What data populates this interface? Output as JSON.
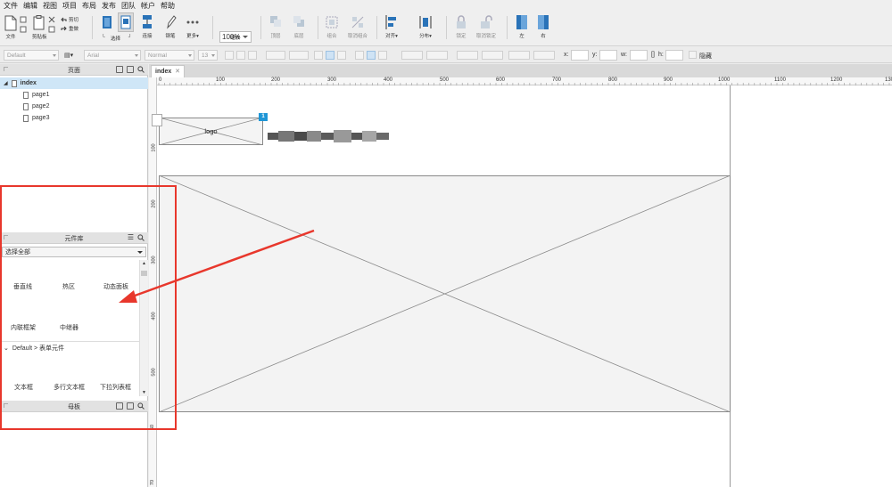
{
  "menu": [
    "文件",
    "编辑",
    "视图",
    "项目",
    "布局",
    "发布",
    "团队",
    "帐户",
    "帮助"
  ],
  "toolbar": {
    "file": "文件",
    "clipboard": "剪贴板",
    "cut": "剪切",
    "redo": "重做",
    "select": "选择",
    "connect": "连接",
    "pen": "钢笔",
    "more": "更多▾",
    "zoom_value": "100%",
    "zoom": "缩放",
    "top": "顶层",
    "bottom": "底层",
    "group": "组合",
    "ungroup": "取消组合",
    "align": "对齐▾",
    "distribute": "分布▾",
    "lock": "锁定",
    "unlock": "取消锁定",
    "left": "左",
    "right": "右"
  },
  "format": {
    "style": "Default",
    "font": "Arial",
    "weight": "Normal",
    "size": "13",
    "x_label": "x:",
    "y_label": "y:",
    "w_label": "w:",
    "h_label": "h:",
    "hidden": "隐藏"
  },
  "pages_panel": {
    "title": "页面",
    "root": "index",
    "children": [
      "page1",
      "page2",
      "page3"
    ]
  },
  "library_panel": {
    "title": "元件库",
    "select_value": "选择全部",
    "items_row1": [
      "垂直线",
      "热区",
      "动态面板"
    ],
    "items_row2": [
      "内联框架",
      "中继器"
    ],
    "group_label": "Default > 表单元件",
    "items_row3": [
      "文本框",
      "多行文本框",
      "下拉列表框"
    ]
  },
  "masters_panel": {
    "title": "母板"
  },
  "editor": {
    "tab": "index",
    "logo_label": "logo",
    "badge": "1"
  },
  "ruler": {
    "h_ticks": [
      "0",
      "100",
      "200",
      "300",
      "400",
      "500",
      "600",
      "700",
      "800",
      "900",
      "1000",
      "1100",
      "1200",
      "130"
    ],
    "v_ticks": [
      "100",
      "200",
      "300",
      "400",
      "500",
      "60",
      "70"
    ]
  },
  "colors": {
    "selection": "#cfe6f7",
    "badge": "#1f96d6",
    "annotation": "#e8372c"
  }
}
